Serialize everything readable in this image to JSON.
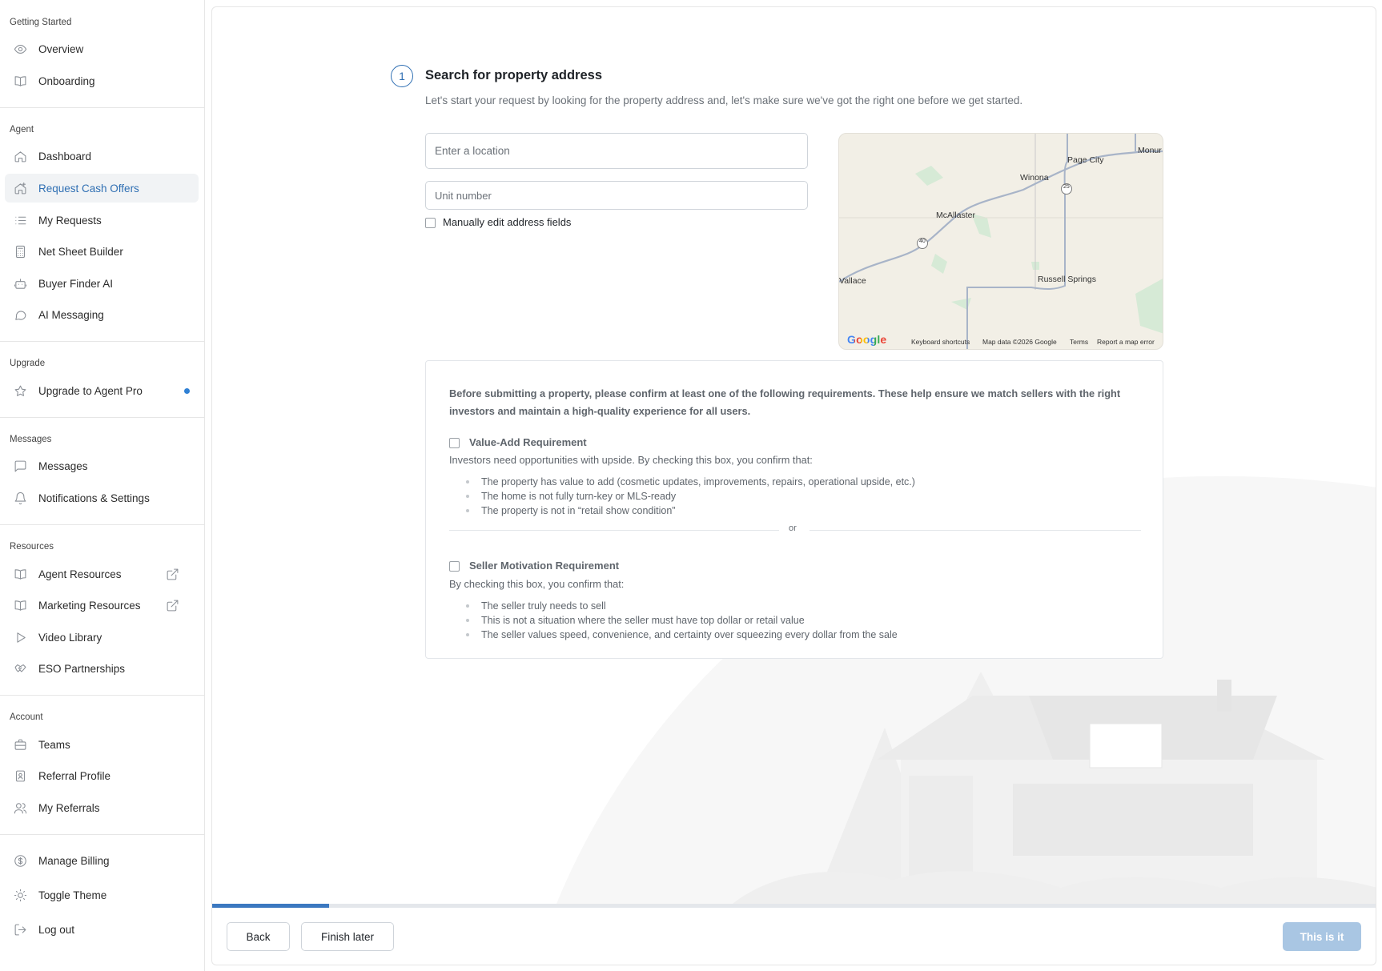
{
  "sidebar": {
    "sections": {
      "getting_started": "Getting Started",
      "agent": "Agent",
      "upgrade": "Upgrade",
      "messages": "Messages",
      "resources": "Resources",
      "account": "Account"
    },
    "items": {
      "overview": {
        "label": "Overview",
        "icon": "eye-icon"
      },
      "onboarding": {
        "label": "Onboarding",
        "icon": "book-icon"
      },
      "dashboard": {
        "label": "Dashboard",
        "icon": "home-icon"
      },
      "request_cash_offers": {
        "label": "Request Cash Offers",
        "icon": "home-plus-icon",
        "active": true
      },
      "my_requests": {
        "label": "My Requests",
        "icon": "list-icon"
      },
      "net_sheet_builder": {
        "label": "Net Sheet Builder",
        "icon": "calculator-icon"
      },
      "buyer_finder_ai": {
        "label": "Buyer Finder AI",
        "icon": "robot-icon"
      },
      "ai_messaging": {
        "label": "AI Messaging",
        "icon": "chat-bubble-icon"
      },
      "upgrade_pro": {
        "label": "Upgrade to Agent Pro",
        "icon": "star-icon"
      },
      "messages": {
        "label": "Messages",
        "icon": "message-square-icon"
      },
      "notifications": {
        "label": "Notifications & Settings",
        "icon": "bell-icon"
      },
      "agent_resources": {
        "label": "Agent Resources",
        "icon": "book-icon"
      },
      "marketing_resources": {
        "label": "Marketing Resources",
        "icon": "book-icon"
      },
      "video_library": {
        "label": "Video Library",
        "icon": "play-icon"
      },
      "eso_partnerships": {
        "label": "ESO Partnerships",
        "icon": "handshake-icon"
      },
      "teams": {
        "label": "Teams",
        "icon": "briefcase-icon"
      },
      "referral_profile": {
        "label": "Referral Profile",
        "icon": "id-card-icon"
      },
      "my_referrals": {
        "label": "My Referrals",
        "icon": "users-icon"
      },
      "manage_billing": {
        "label": "Manage Billing",
        "icon": "dollar-circle-icon"
      },
      "toggle_theme": {
        "label": "Toggle Theme",
        "icon": "sun-icon"
      },
      "log_out": {
        "label": "Log out",
        "icon": "logout-icon"
      }
    }
  },
  "step": {
    "number": "1",
    "title": "Search for property address",
    "description": "Let's start your request by looking for the property address and, let's make sure we've got the right one before we get started."
  },
  "form": {
    "location_placeholder": "Enter a location",
    "unit_placeholder": "Unit number",
    "manual_edit_label": "Manually edit address fields"
  },
  "map": {
    "towns": {
      "page_city": "Page City",
      "monument": "Monur",
      "winona": "Winona",
      "mcallaster": "McAllaster",
      "wallace": "Vallace",
      "russell_springs": "Russell Springs"
    },
    "route_25": "25",
    "route_40": "40",
    "google": "Google",
    "footer": {
      "shortcuts": "Keyboard shortcuts",
      "data": "Map data ©2026 Google",
      "terms": "Terms",
      "report": "Report a map error"
    }
  },
  "requirements": {
    "intro": "Before submitting a property, please confirm at least one of the following requirements. These help ensure we match sellers with the right investors and maintain a high-quality experience for all users.",
    "value_add": {
      "title": "Value-Add Requirement",
      "subtitle": "Investors need opportunities with upside. By checking this box, you confirm that:",
      "bullets": [
        "The property has value to add (cosmetic updates, improvements, repairs, operational upside, etc.)",
        "The home is not fully turn-key or MLS-ready",
        "The property is not in “retail show condition”"
      ]
    },
    "or": "or",
    "seller_motivation": {
      "title": "Seller Motivation Requirement",
      "subtitle": "By checking this box, you confirm that:",
      "bullets": [
        "The seller truly needs to sell",
        "This is not a situation where the seller must have top dollar or retail value",
        "The seller values speed, convenience, and certainty over squeezing every dollar from the sale"
      ]
    }
  },
  "progress": {
    "value": 0.1
  },
  "footer": {
    "back": "Back",
    "finish_later": "Finish later",
    "confirm": "This is it"
  },
  "colors": {
    "accent": "#2f6fb3",
    "progress": "#3b78c0",
    "primary_disabled": "#a9c6e3",
    "notification_dot": "#2f80d4"
  }
}
